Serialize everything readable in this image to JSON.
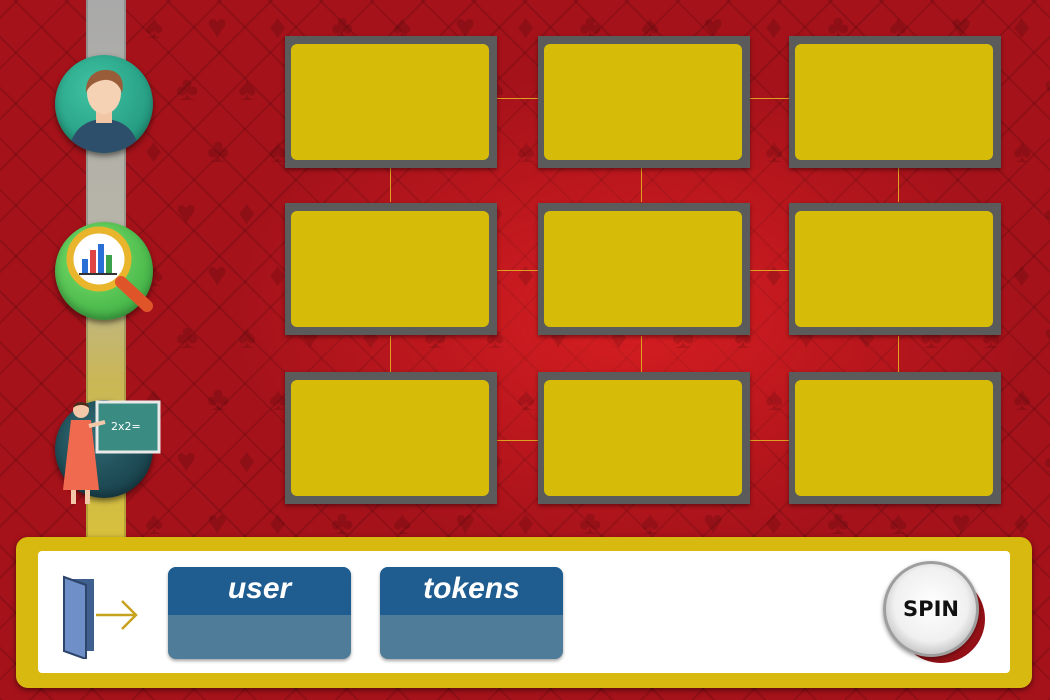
{
  "background": {
    "base_color": "#a5121a"
  },
  "sidebar": {
    "buttons": [
      {
        "name": "profile",
        "icon": "user-avatar-icon"
      },
      {
        "name": "statistics",
        "icon": "chart-magnifier-icon"
      },
      {
        "name": "tutorial",
        "icon": "teacher-blackboard-icon"
      }
    ],
    "tutorial_board_text": "2x2="
  },
  "grid": {
    "rows": 3,
    "columns": 3,
    "tile_color": "#d6bb08",
    "tile_frame_color": "#5b5b5b",
    "connector_color": "#e0a020"
  },
  "bottom_bar": {
    "frame_color": "#d7b90f",
    "exit_icon": "exit-door-icon",
    "user_label": "user",
    "user_value": "",
    "tokens_label": "tokens",
    "tokens_value": "",
    "box_color": "#1f5d91",
    "spin_label": "SPIN"
  }
}
